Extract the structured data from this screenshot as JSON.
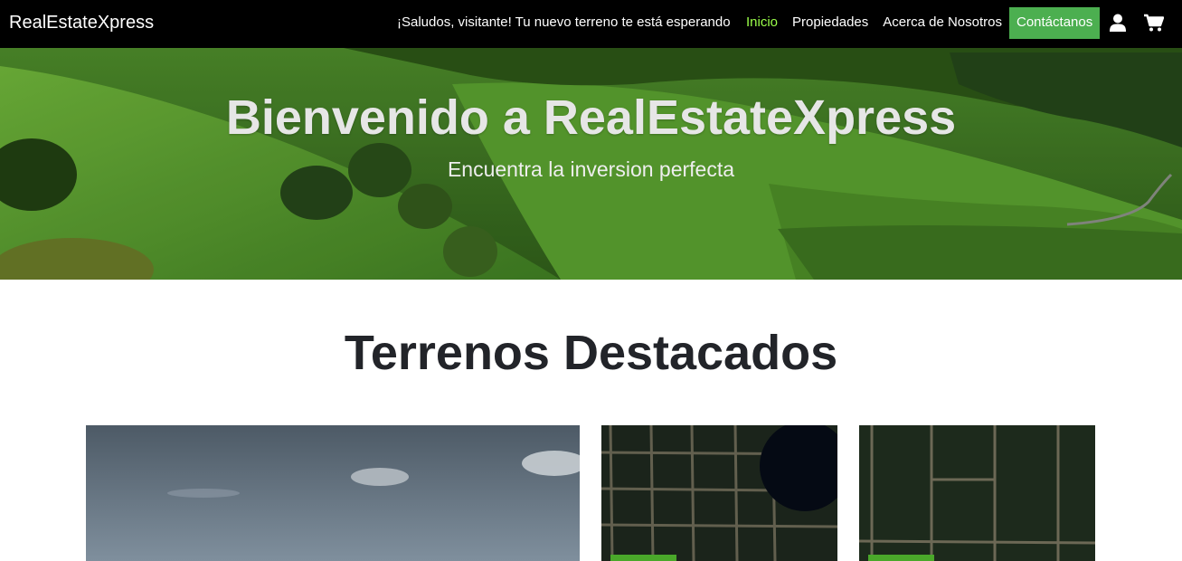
{
  "navbar": {
    "brand": "RealEstateXpress",
    "greeting": "¡Saludos, visitante! Tu nuevo terreno te está esperando",
    "links": [
      {
        "label": "Inicio",
        "active": true
      },
      {
        "label": "Propiedades",
        "active": false
      },
      {
        "label": "Acerca de Nosotros",
        "active": false
      },
      {
        "label": "Contáctanos",
        "active": false
      }
    ],
    "icons": [
      "user-icon",
      "cart-icon"
    ],
    "accent_active": "#9bff4a",
    "cta_color": "#4caf50"
  },
  "hero": {
    "title": "Bienvenido a RealEstateXpress",
    "subtitle": "Encuentra la inversion perfecta"
  },
  "featured": {
    "title": "Terrenos Destacados",
    "cards": [
      {
        "image": "sky-landscape-image"
      },
      {
        "image": "aerial-lots-lake-image"
      },
      {
        "image": "aerial-lots-grid-image"
      }
    ]
  }
}
